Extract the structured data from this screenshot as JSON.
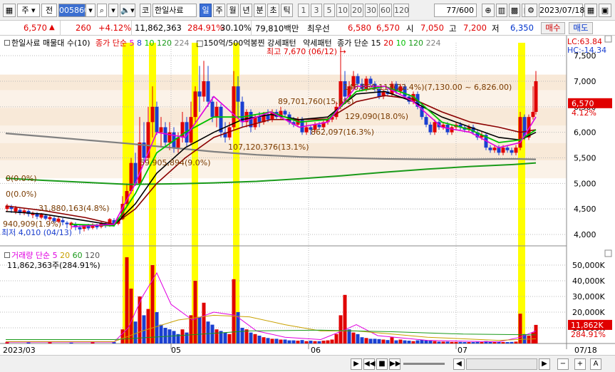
{
  "toolbar": {
    "type_label": "주",
    "prev_label": "전",
    "code_value": "005860",
    "stock_name": "한일사료",
    "code_prefix": "코",
    "periods": [
      "일",
      "주",
      "월",
      "년",
      "분",
      "초",
      "틱"
    ],
    "active_period": "일",
    "numbers": [
      "1",
      "3",
      "5",
      "10",
      "20",
      "30",
      "60",
      "120"
    ],
    "page_count": "77",
    "page_total": "/600",
    "date": "2023/07/18"
  },
  "quote": {
    "price": "6,570",
    "change_arrow": "▲",
    "change": "260",
    "change_pct": "+4.12%",
    "volume": "11,862,363",
    "volume_ratio": "284.91%",
    "turnover": "30.10%",
    "amount": "79,810백만",
    "best_label": "최우선",
    "best_price": "6,580",
    "best_price2": "6,570",
    "open_label": "시",
    "open": "7,050",
    "high_label": "고",
    "high": "7,200",
    "low_label": "저",
    "low": "6,350",
    "buy_label": "매수",
    "sell_label": "매도"
  },
  "chart_header": {
    "title": "한일사료 매물대 수(10)",
    "ma_label": "종가 단순",
    "ma_periods": [
      "5",
      "8",
      "10",
      "120",
      "224"
    ],
    "pattern_label": "150억/500억봉찐 강세패턴",
    "weak_label": "약세패턴",
    "ma2_label": "종가 단순 15",
    "ma2_periods": [
      "20",
      "10",
      "120",
      "224"
    ],
    "lc": "LC:63.84",
    "hc": "HC:-14.34"
  },
  "annotations": {
    "high_note": "최고 7,670 (06/12) →",
    "low_note": "최저 4,010 (04/13)",
    "vp1": "146,860,113(22.4%)(7,130.00 ~ 6,826.00)",
    "vp2": "89,701,760(15.6%)",
    "vp3": "129,090(18.0%)",
    "vp4": "862,097(16.3%)",
    "vp5": "107,120,376(13.1%)",
    "vp6": "59,905,894(9.0%)",
    "vp7": "31,880,163(4.8%)",
    "vp8": "0(0.0%)",
    "vp9": "0(0.0%)",
    "vp10": "940,909(1.9%)"
  },
  "price_axis": {
    "ticks": [
      "7,500",
      "7,000",
      "6,500",
      "6,000",
      "5,500",
      "5,000",
      "4,500",
      "4,000"
    ],
    "current": "6,570",
    "current_pct": "4.12%"
  },
  "volume_panel": {
    "label": "거래량 단순",
    "ma_periods": [
      "5",
      "20",
      "60",
      "120"
    ],
    "value": "11,862,363주(284.91%)",
    "ticks": [
      "50,000K",
      "40,000K",
      "30,000K",
      "20,000K",
      "10,000K"
    ],
    "current": "11,862K",
    "current_pct": "284.91%"
  },
  "date_axis": {
    "labels": [
      "2023/03",
      "05",
      "06",
      "07"
    ],
    "right_label": "07/18"
  },
  "colors": {
    "up": "#e00000",
    "down": "#1a3fd1",
    "highlight": "#ffff00",
    "ma5": "#e000e0",
    "ma10": "#00c000",
    "ma20": "#000000",
    "ma60": "#8b0000",
    "ma120": "#1a9a1a",
    "ma224": "#808080"
  }
}
